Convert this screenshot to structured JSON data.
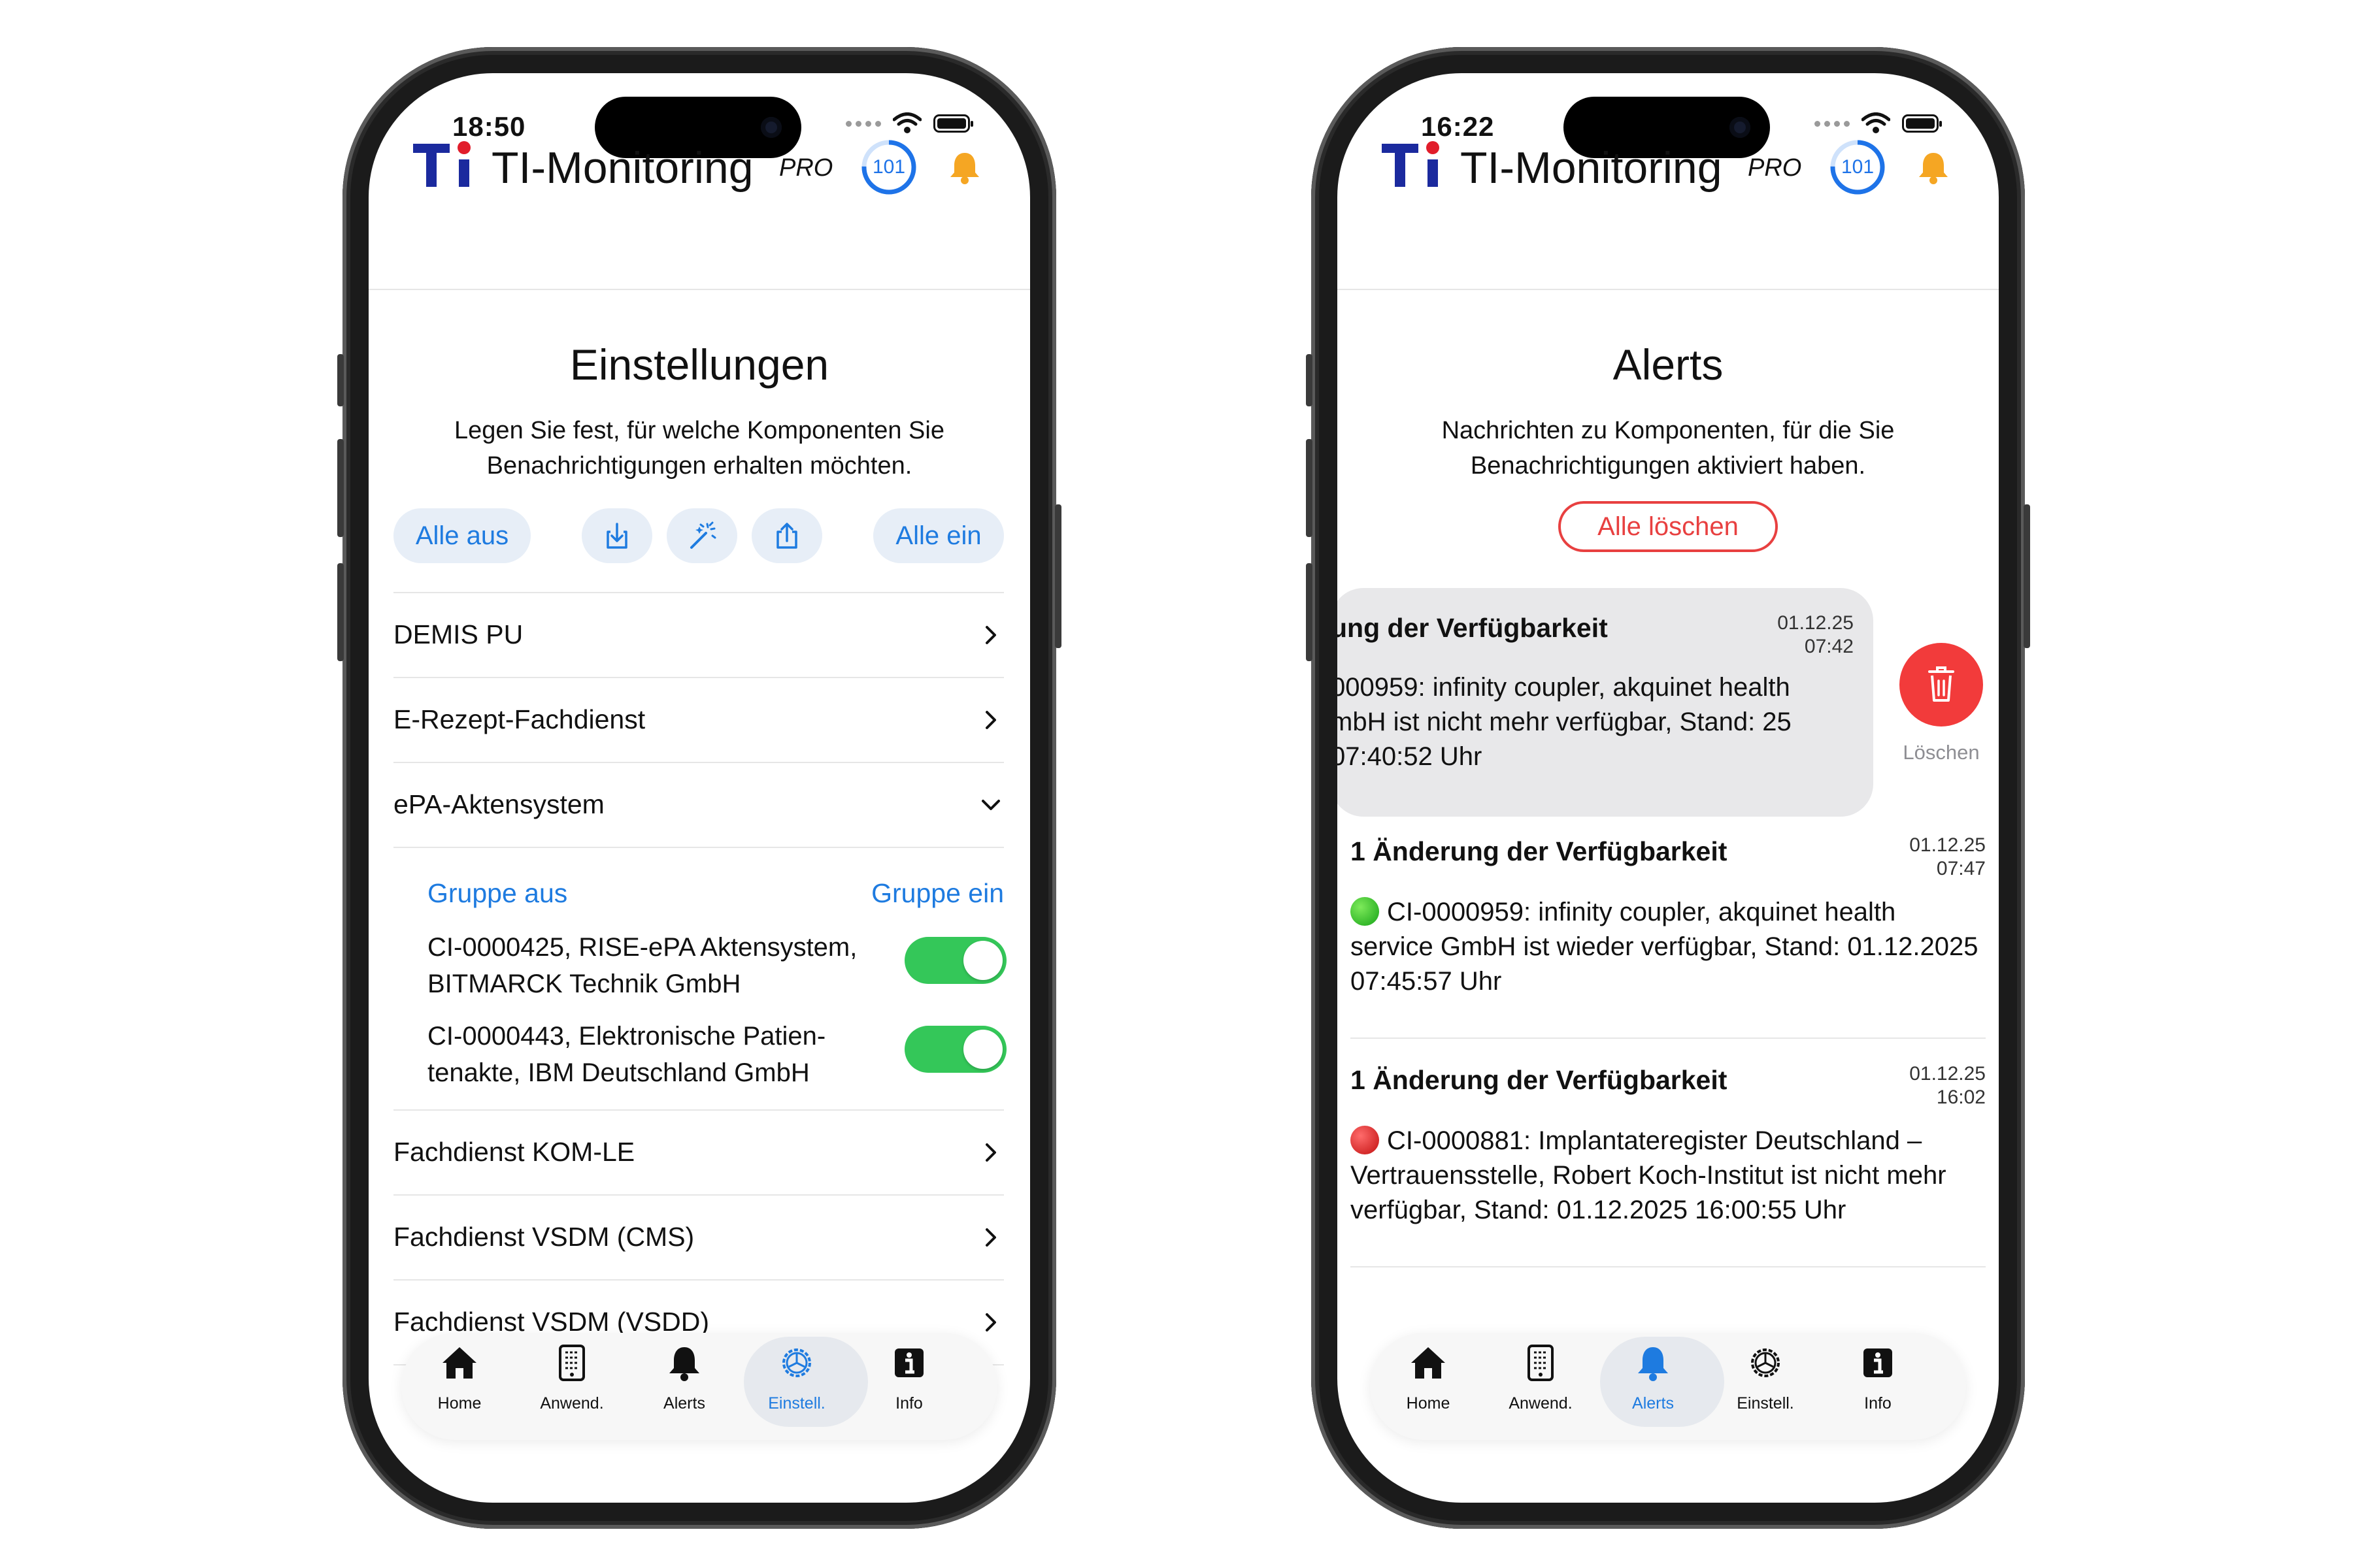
{
  "colors": {
    "accent": "#1e7be0",
    "toggle_on": "#34c759",
    "delete": "#f23b3b",
    "bell": "#f5a623"
  },
  "left": {
    "status": {
      "time": "18:50"
    },
    "app": {
      "title": "TI-Monitoring",
      "badge": "PRO",
      "counter": "101"
    },
    "page": {
      "title": "Einstellungen",
      "description": "Legen Sie fest, für welche Komponenten Sie Benachrichtigungen erhalten möchten."
    },
    "actions": {
      "all_off": "Alle aus",
      "all_on": "Alle ein",
      "icons": [
        "import-icon",
        "magic-wand-icon",
        "share-icon"
      ]
    },
    "rows": {
      "demis": "DEMIS PU",
      "erezept": "E-Rezept-Fachdienst",
      "epa": "ePA-Aktensystem",
      "komle": "Fachdienst KOM-LE",
      "vsdm_cms": "Fachdienst VSDM (CMS)",
      "vsdm_vsdd": "Fachdienst VSDM (VSDD)"
    },
    "group": {
      "off": "Gruppe aus",
      "on": "Gruppe ein",
      "items": [
        {
          "text": "CI-0000425, RISE-ePA Aktensystem, BITMARCK Technik GmbH",
          "enabled": true
        },
        {
          "text": "CI-0000443, Elektronische Patien-tenakte, IBM Deutschland GmbH",
          "enabled": true
        }
      ]
    },
    "tabs": {
      "home": "Home",
      "apps": "Anwend.",
      "alerts": "Alerts",
      "settings": "Einstell.",
      "info": "Info",
      "active": "settings"
    }
  },
  "right": {
    "status": {
      "time": "16:22"
    },
    "app": {
      "title": "TI-Monitoring",
      "badge": "PRO",
      "counter": "101"
    },
    "page": {
      "title": "Alerts",
      "description": "Nachrichten zu Komponenten, für die Sie Benachrichtigungen aktiviert haben."
    },
    "clear_all": "Alle löschen",
    "delete_label": "Löschen",
    "alerts": [
      {
        "title": "ung der Verfügbarkeit",
        "date": "01.12.25",
        "time": "07:42",
        "body": "000959: infinity coupler, akquinet health mbH ist nicht mehr verfügbar, Stand: 25 07:40:52 Uhr"
      },
      {
        "title": "1 Änderung der Verfügbarkeit",
        "date": "01.12.25",
        "time": "07:47",
        "status": "green",
        "body": "CI-0000959: infinity coupler, akquinet health service GmbH ist wieder verfügbar, Stand: 01.12.2025 07:45:57 Uhr"
      },
      {
        "title": "1 Änderung der Verfügbarkeit",
        "date": "01.12.25",
        "time": "16:02",
        "status": "red",
        "body": "CI-0000881: Implantateregister Deutschland – Vertrauensstelle, Robert Koch-Institut ist nicht mehr verfügbar, Stand: 01.12.2025 16:00:55 Uhr"
      }
    ],
    "tabs": {
      "home": "Home",
      "apps": "Anwend.",
      "alerts": "Alerts",
      "settings": "Einstell.",
      "info": "Info",
      "active": "alerts"
    }
  }
}
